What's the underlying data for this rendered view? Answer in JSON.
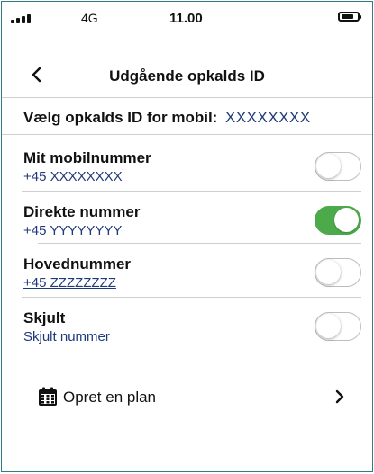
{
  "status_bar": {
    "network": "4G",
    "time": "11.00"
  },
  "nav": {
    "title": "Udgående opkalds ID"
  },
  "callerid": {
    "label": "Vælg opkalds ID for mobil:",
    "value": "XXXXXXXX"
  },
  "options": [
    {
      "title": "Mit mobilnummer",
      "number": "+45  XXXXXXXX",
      "enabled": false
    },
    {
      "title": "Direkte nummer",
      "number": "+45  YYYYYYYY",
      "enabled": true
    },
    {
      "title": "Hovednummer",
      "number": "+45  ZZZZZZZZ",
      "enabled": false
    },
    {
      "title": "Skjult",
      "number": "Skjult nummer",
      "enabled": false
    }
  ],
  "plan": {
    "label": "Opret en plan"
  },
  "colors": {
    "toggle_on": "#4caa4a",
    "accent_text": "#1f3a7a",
    "frame": "#2f7d83"
  }
}
